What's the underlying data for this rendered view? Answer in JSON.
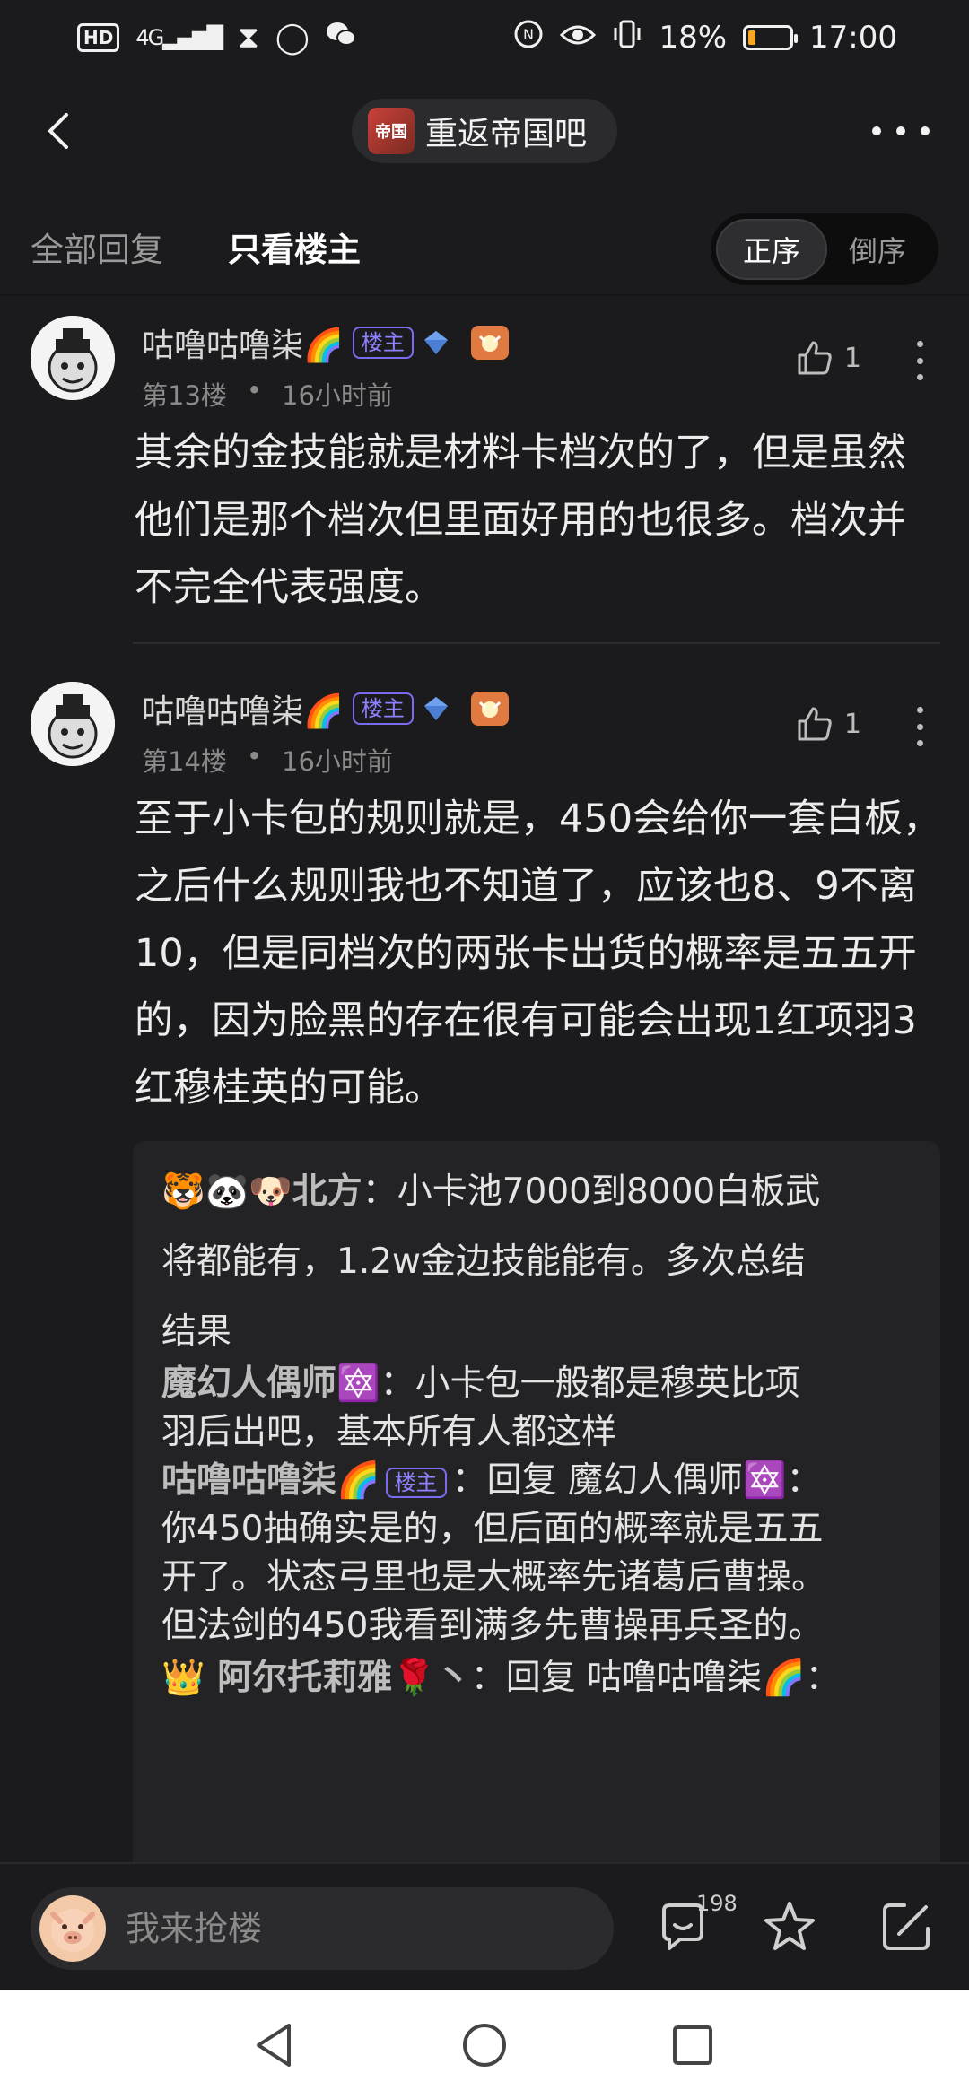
{
  "status_bar": {
    "left_icons": [
      "hd-icon",
      "signal-4g-icon",
      "hourglass-icon",
      "sync-icon",
      "wechat-icon"
    ],
    "hd": "HD",
    "network": "4G",
    "right_icons": [
      "nfc-icon",
      "eye-icon",
      "vibrate-icon"
    ],
    "battery": "18%",
    "battery_level": 0.18,
    "time": "17:00"
  },
  "header": {
    "forum_logo_text": "帝国",
    "forum_name": "重返帝国吧"
  },
  "tabs": {
    "all_replies": "全部回复",
    "host_only": "只看楼主",
    "order_asc": "正序",
    "order_desc": "倒序"
  },
  "posts": [
    {
      "username": "咕噜咕噜柒🌈",
      "host_badge": "楼主",
      "floor": "第13楼",
      "dot": "•",
      "time": "16小时前",
      "likes": "1",
      "content": "其余的金技能就是材料卡档次的了，但是虽然他们是那个档次但里面好用的也很多。档次并不完全代表强度。"
    },
    {
      "username": "咕噜咕噜柒🌈",
      "host_badge": "楼主",
      "floor": "第14楼",
      "dot": "•",
      "time": "16小时前",
      "likes": "1",
      "content": "至于小卡包的规则就是，450会给你一套白板，之后什么规则我也不知道了，应该也8、9不离10，但是同档次的两张卡出货的概率是五五开的，因为脸黑的存在很有可能会出现1红项羽3红穆桂英的可能。"
    }
  ],
  "quote": {
    "r1_name": "🐯🐼🐶北方",
    "r1_text_a": "：小卡池7000到8000白板武",
    "r1_text_b": "将都能有，1.2w金边技能能有。多次总结",
    "r1_text_c": "结果",
    "r2_name": "魔幻人偶师🔯",
    "r2_text_a": "：小卡包一般都是穆英比项",
    "r2_text_b": "羽后出吧，基本所有人都这样",
    "r3_name": "咕噜咕噜柒🌈",
    "r3_badge": "楼主",
    "r3_text_a": "：回复 魔幻人偶师🔯：",
    "r3_text_b": "你450抽确实是的，但后面的概率就是五五",
    "r3_text_c": "开了。状态弓里也是大概率先诸葛后曹操。",
    "r3_text_d": "但法剑的450我看到满多先曹操再兵圣的。",
    "r4_name": "👑 阿尔托莉雅🌹丶",
    "r4_text_a": "：回复 咕噜咕噜柒🌈："
  },
  "input_bar": {
    "placeholder": "我来抢楼",
    "comment_count": "198"
  },
  "colors": {
    "background": "#1b1b1d",
    "accent_badge": "#8d82ff",
    "battery_low": "#f5a623",
    "text_primary": "#ececec",
    "text_secondary": "#8a8a8a"
  }
}
